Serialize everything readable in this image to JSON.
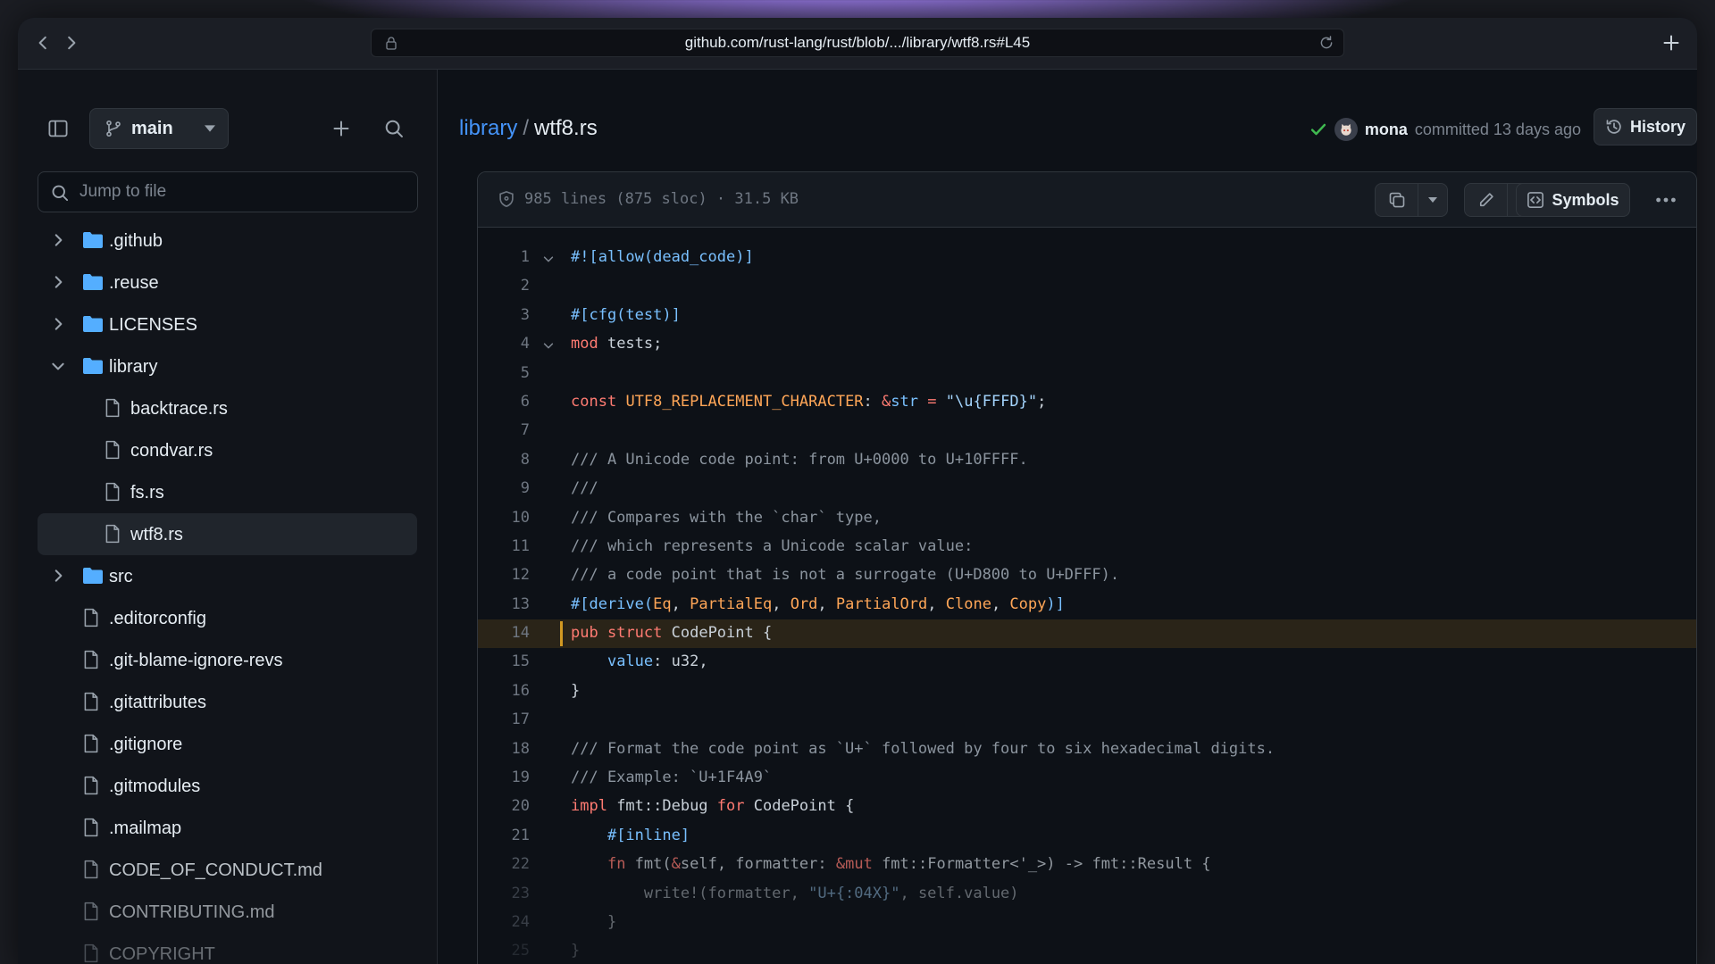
{
  "browser": {
    "url": "github.com/rust-lang/rust/blob/.../library/wtf8.rs#L45"
  },
  "sidebar": {
    "branch": "main",
    "jump_placeholder": "Jump to file",
    "tree": [
      {
        "label": ".github",
        "type": "folder",
        "expanded": false
      },
      {
        "label": ".reuse",
        "type": "folder",
        "expanded": false
      },
      {
        "label": "LICENSES",
        "type": "folder",
        "expanded": false
      },
      {
        "label": "library",
        "type": "folder",
        "expanded": true
      },
      {
        "label": "backtrace.rs",
        "type": "file",
        "child": true
      },
      {
        "label": "condvar.rs",
        "type": "file",
        "child": true
      },
      {
        "label": "fs.rs",
        "type": "file",
        "child": true
      },
      {
        "label": "wtf8.rs",
        "type": "file",
        "child": true,
        "selected": true
      },
      {
        "label": "src",
        "type": "folder",
        "expanded": false
      },
      {
        "label": ".editorconfig",
        "type": "file"
      },
      {
        "label": ".git-blame-ignore-revs",
        "type": "file"
      },
      {
        "label": ".gitattributes",
        "type": "file"
      },
      {
        "label": ".gitignore",
        "type": "file"
      },
      {
        "label": ".gitmodules",
        "type": "file"
      },
      {
        "label": ".mailmap",
        "type": "file"
      },
      {
        "label": "CODE_OF_CONDUCT.md",
        "type": "file"
      },
      {
        "label": "CONTRIBUTING.md",
        "type": "file"
      },
      {
        "label": "COPYRIGHT",
        "type": "file"
      }
    ]
  },
  "header": {
    "crumb_dir": "library",
    "crumb_sep": "/",
    "crumb_file": "wtf8.rs",
    "commit_user": "mona",
    "commit_text": "committed 13 days ago",
    "history_label": "History"
  },
  "file": {
    "meta": "985 lines (875 sloc) · 31.5 KB",
    "symbols_label": "Symbols"
  },
  "code_lines": [
    {
      "n": "1",
      "fold": true,
      "html": "<span class=\"a\">#![allow(dead_code)]</span>"
    },
    {
      "n": "2",
      "html": ""
    },
    {
      "n": "3",
      "html": "<span class=\"a\">#[cfg(test)]</span>"
    },
    {
      "n": "4",
      "fold": true,
      "html": "<span class=\"k\">mod</span> tests;"
    },
    {
      "n": "5",
      "html": ""
    },
    {
      "n": "6",
      "html": "<span class=\"k\">const</span> <span class=\"t\">UTF8_REPLACEMENT_CHARACTER</span>: <span class=\"k\">&amp;</span><span class=\"a\">str</span> <span class=\"k\">=</span> <span class=\"s\">\"\\u{FFFD}\"</span>;"
    },
    {
      "n": "7",
      "html": ""
    },
    {
      "n": "8",
      "html": "<span class=\"c\">/// A Unicode code point: from U+0000 to U+10FFFF.</span>"
    },
    {
      "n": "9",
      "html": "<span class=\"c\">///</span>"
    },
    {
      "n": "10",
      "html": "<span class=\"c\">/// Compares with the `char` type,</span>"
    },
    {
      "n": "11",
      "html": "<span class=\"c\">/// which represents a Unicode scalar value:</span>"
    },
    {
      "n": "12",
      "html": "<span class=\"c\">/// a code point that is not a surrogate (U+D800 to U+DFFF).</span>"
    },
    {
      "n": "13",
      "html": "<span class=\"a\">#[derive(</span><span class=\"t\">Eq</span>, <span class=\"t\">PartialEq</span>, <span class=\"t\">Ord</span>, <span class=\"t\">PartialOrd</span>, <span class=\"t\">Clone</span>, <span class=\"t\">Copy</span><span class=\"a\">)]</span>"
    },
    {
      "n": "14",
      "hl": true,
      "html": "<span class=\"k\">pub</span> <span class=\"k\">struct</span> CodePoint {"
    },
    {
      "n": "15",
      "html": "    <span class=\"a\">value</span>: u32,"
    },
    {
      "n": "16",
      "html": "}"
    },
    {
      "n": "17",
      "html": ""
    },
    {
      "n": "18",
      "html": "<span class=\"c\">/// Format the code point as `U+` followed by four to six hexadecimal digits.</span>"
    },
    {
      "n": "19",
      "html": "<span class=\"c\">/// Example: `U+1F4A9`</span>"
    },
    {
      "n": "20",
      "html": "<span class=\"k\">impl</span> fmt::Debug <span class=\"k\">for</span> CodePoint {"
    },
    {
      "n": "21",
      "html": "    <span class=\"a\">#[inline]</span>"
    },
    {
      "n": "22",
      "html": "    <span class=\"k\">fn</span> fmt(<span class=\"k\">&amp;</span>self, formatter: <span class=\"k\">&amp;mut</span> fmt::Formatter&lt;'_&gt;) -&gt; fmt::Result {"
    },
    {
      "n": "23",
      "html": "        write!(formatter, <span class=\"s\">\"U+{:04X}\"</span>, self.value)"
    },
    {
      "n": "24",
      "html": "    }"
    },
    {
      "n": "25",
      "html": "}"
    }
  ]
}
